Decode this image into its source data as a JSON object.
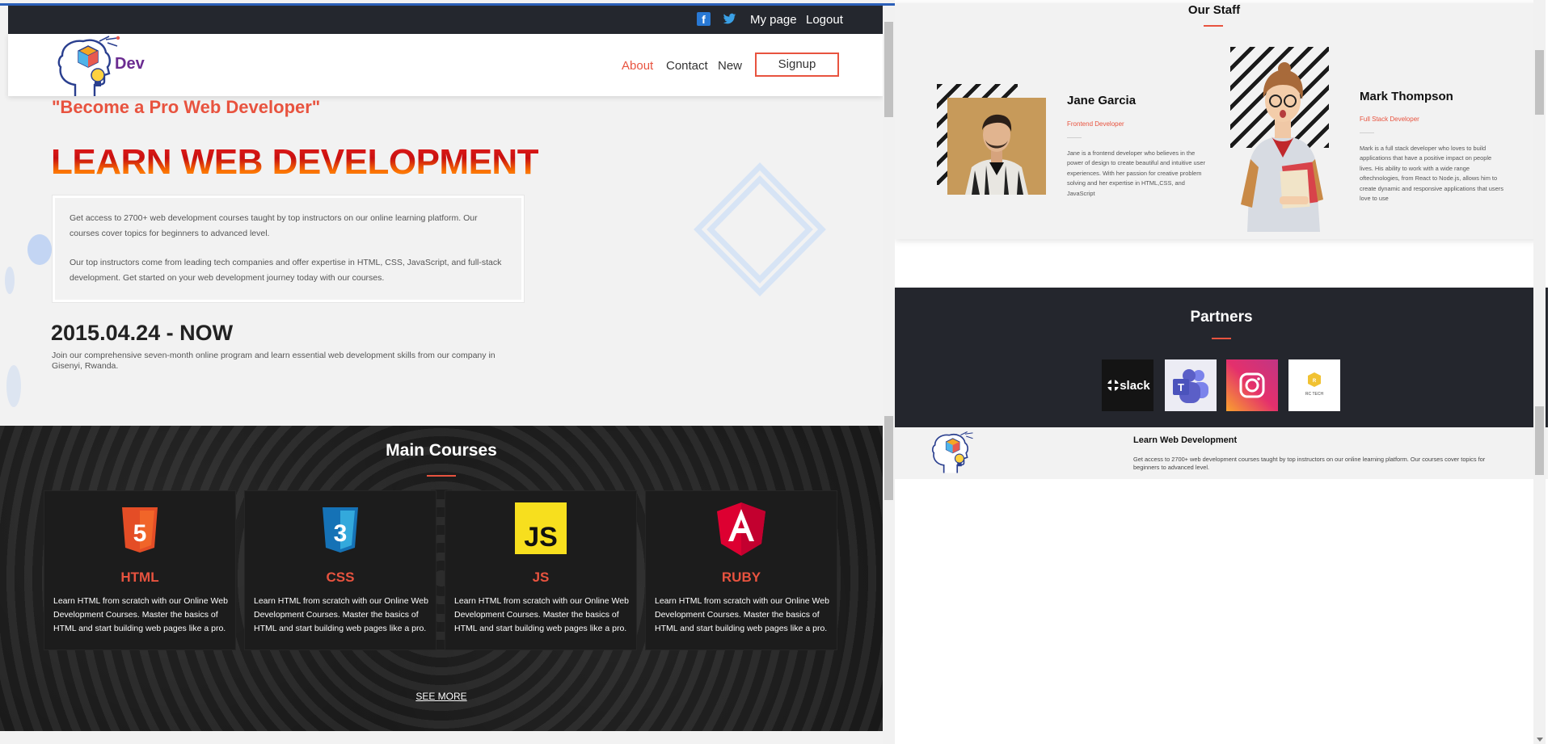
{
  "topbar": {
    "my_page": "My page",
    "logout": "Logout",
    "facebook_icon": "facebook-icon",
    "twitter_icon": "twitter-icon"
  },
  "brand": {
    "name": "Dev",
    "color": "#6b2c91"
  },
  "nav": {
    "about": "About",
    "contact": "Contact",
    "new": "New",
    "signup": "Signup",
    "accent": "#e8533f"
  },
  "hero": {
    "quote": "\"Become a Pro Web Developer\"",
    "title": "LEARN WEB DEVELOPMENT",
    "para1": "Get access to 2700+ web development courses taught by top instructors on our online learning platform. Our courses cover topics for beginners to advanced level.",
    "para2": "Our top instructors come from leading tech companies and offer expertise in HTML, CSS, JavaScript, and full-stack development. Get started on your web development journey today with our courses.",
    "date": "2015.04.24 - NOW",
    "desc": "Join our comprehensive seven-month online program and learn essential web development skills from our company in Gisenyi, Rwanda."
  },
  "courses": {
    "title": "Main Courses",
    "items": [
      {
        "name": "HTML",
        "icon": "html5-icon",
        "desc": "Learn HTML from scratch with our Online Web Development Courses. Master the basics of HTML and start building web pages like a pro."
      },
      {
        "name": "CSS",
        "icon": "css3-icon",
        "desc": "Learn HTML from scratch with our Online Web Development Courses. Master the basics of HTML and start building web pages like a pro."
      },
      {
        "name": "JS",
        "icon": "javascript-icon",
        "desc": "Learn HTML from scratch with our Online Web Development Courses. Master the basics of HTML and start building web pages like a pro."
      },
      {
        "name": "RUBY",
        "icon": "angular-icon",
        "desc": "Learn HTML from scratch with our Online Web Development Courses. Master the basics of HTML and start building web pages like a pro."
      }
    ],
    "see_more": "SEE MORE"
  },
  "staff": {
    "title": "Our Staff",
    "members": [
      {
        "name": "Jane Garcia",
        "role": "Frontend Developer",
        "bio": "Jane is a frontend developer who believes in the power of design to create beautiful and intuitive user experiences. With her passion for creative problem solving and her expertise in HTML,CSS, and JavaScript"
      },
      {
        "name": "Mark Thompson",
        "role": "Full Stack Developer",
        "bio": "Mark is a full stack developer who loves to build applications that have a positive impact on people lives. His ability to work with a wide range oftechnologies, from React to Node.js, allows him to create dynamic and responsive applications that users love to use"
      }
    ]
  },
  "partners": {
    "title": "Partners",
    "logos": [
      "slack",
      "teams",
      "instagram",
      "rc-tech"
    ]
  },
  "footer": {
    "title": "Learn Web Development",
    "text": "Get access to 2700+ web development courses taught by top instructors on our online learning platform. Our courses cover topics for beginners to advanced level."
  }
}
